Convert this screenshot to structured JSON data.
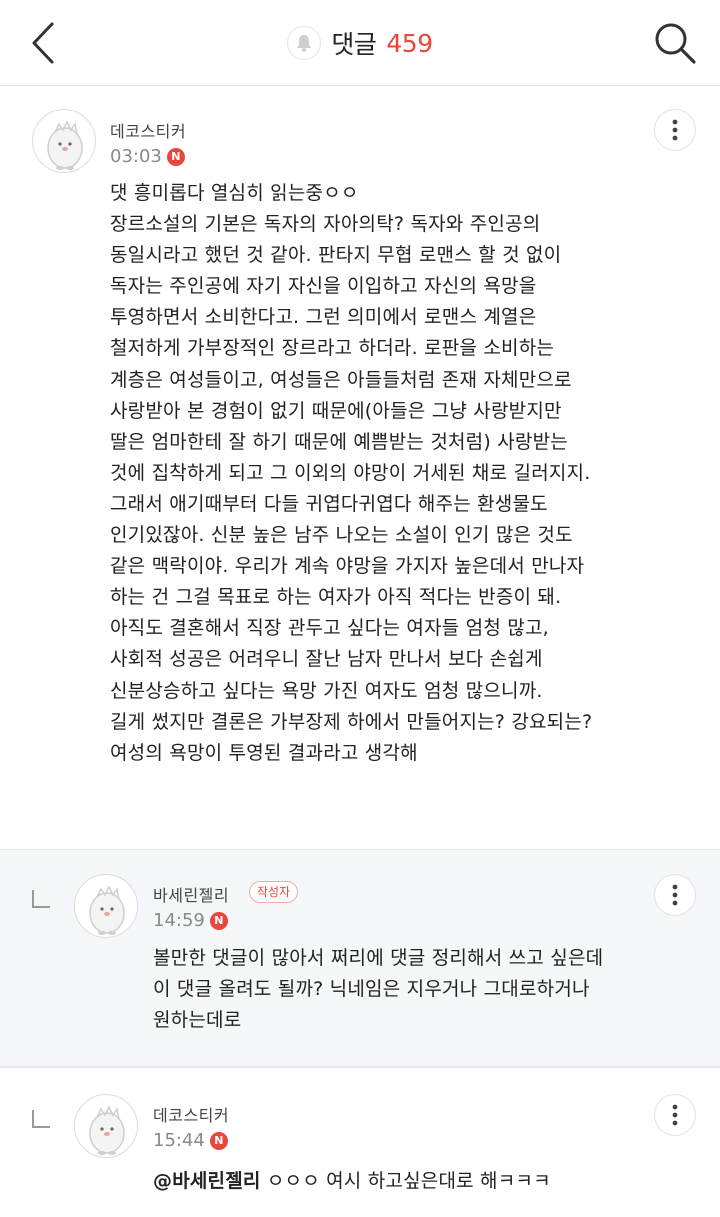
{
  "header": {
    "title": "댓글",
    "count": "459"
  },
  "comments": [
    {
      "nickname": "데코스티커",
      "time": "03:03",
      "new_badge": "N",
      "body": "댓 흥미롭다 열심히 읽는중ㅇㅇ\n장르소설의 기본은 독자의 자아의탁? 독자와 주인공의\n동일시라고 했던 것 같아. 판타지 무협 로맨스 할 것 없이\n독자는 주인공에 자기 자신을 이입하고 자신의 욕망을\n투영하면서 소비한다고. 그런 의미에서 로맨스 계열은\n철저하게 가부장적인 장르라고 하더라. 로판을 소비하는\n계층은 여성들이고, 여성들은 아들들처럼 존재 자체만으로\n사랑받아 본 경험이 없기 때문에(아들은 그냥 사랑받지만\n딸은 엄마한테 잘 하기 때문에 예쁨받는 것처럼) 사랑받는\n것에 집착하게 되고 그 이외의 야망이 거세된 채로 길러지지.\n그래서 애기때부터 다들 귀엽다귀엽다 해주는 환생물도\n인기있잖아. 신분 높은 남주 나오는 소설이 인기 많은 것도\n같은 맥락이야. 우리가 계속 야망을 가지자 높은데서 만나자\n하는 건 그걸 목표로 하는 여자가 아직 적다는 반증이 돼.\n아직도 결혼해서 직장 관두고 싶다는 여자들 엄청 많고,\n사회적 성공은 어려우니 잘난 남자 만나서 보다 손쉽게\n신분상승하고 싶다는 욕망 가진 여자도 엄청 많으니까.\n길게 썼지만 결론은 가부장제 하에서 만들어지는? 강요되는?\n여성의 욕망이 투영된 결과라고 생각해"
    },
    {
      "nickname": "바세린젤리",
      "author_badge": "작성자",
      "time": "14:59",
      "new_badge": "N",
      "body": "볼만한 댓글이 많아서 쩌리에 댓글 정리해서 쓰고 싶은데\n이 댓글 올려도 될까? 닉네임은 지우거나 그대로하거나\n원하는데로"
    },
    {
      "nickname": "데코스티커",
      "time": "15:44",
      "new_badge": "N",
      "mention": "@바세린젤리",
      "body": " ㅇㅇㅇ 여시 하고싶은대로 해ㅋㅋㅋ"
    }
  ],
  "icons": {
    "back": "chevron-left-icon",
    "search": "search-icon",
    "bell": "bell-icon",
    "more": "more-vertical-icon",
    "reply": "reply-arrow-icon",
    "avatar": "penguin-avatar-icon"
  },
  "colors": {
    "accent": "#e8483c",
    "reply_bg": "#f5f7fa"
  }
}
